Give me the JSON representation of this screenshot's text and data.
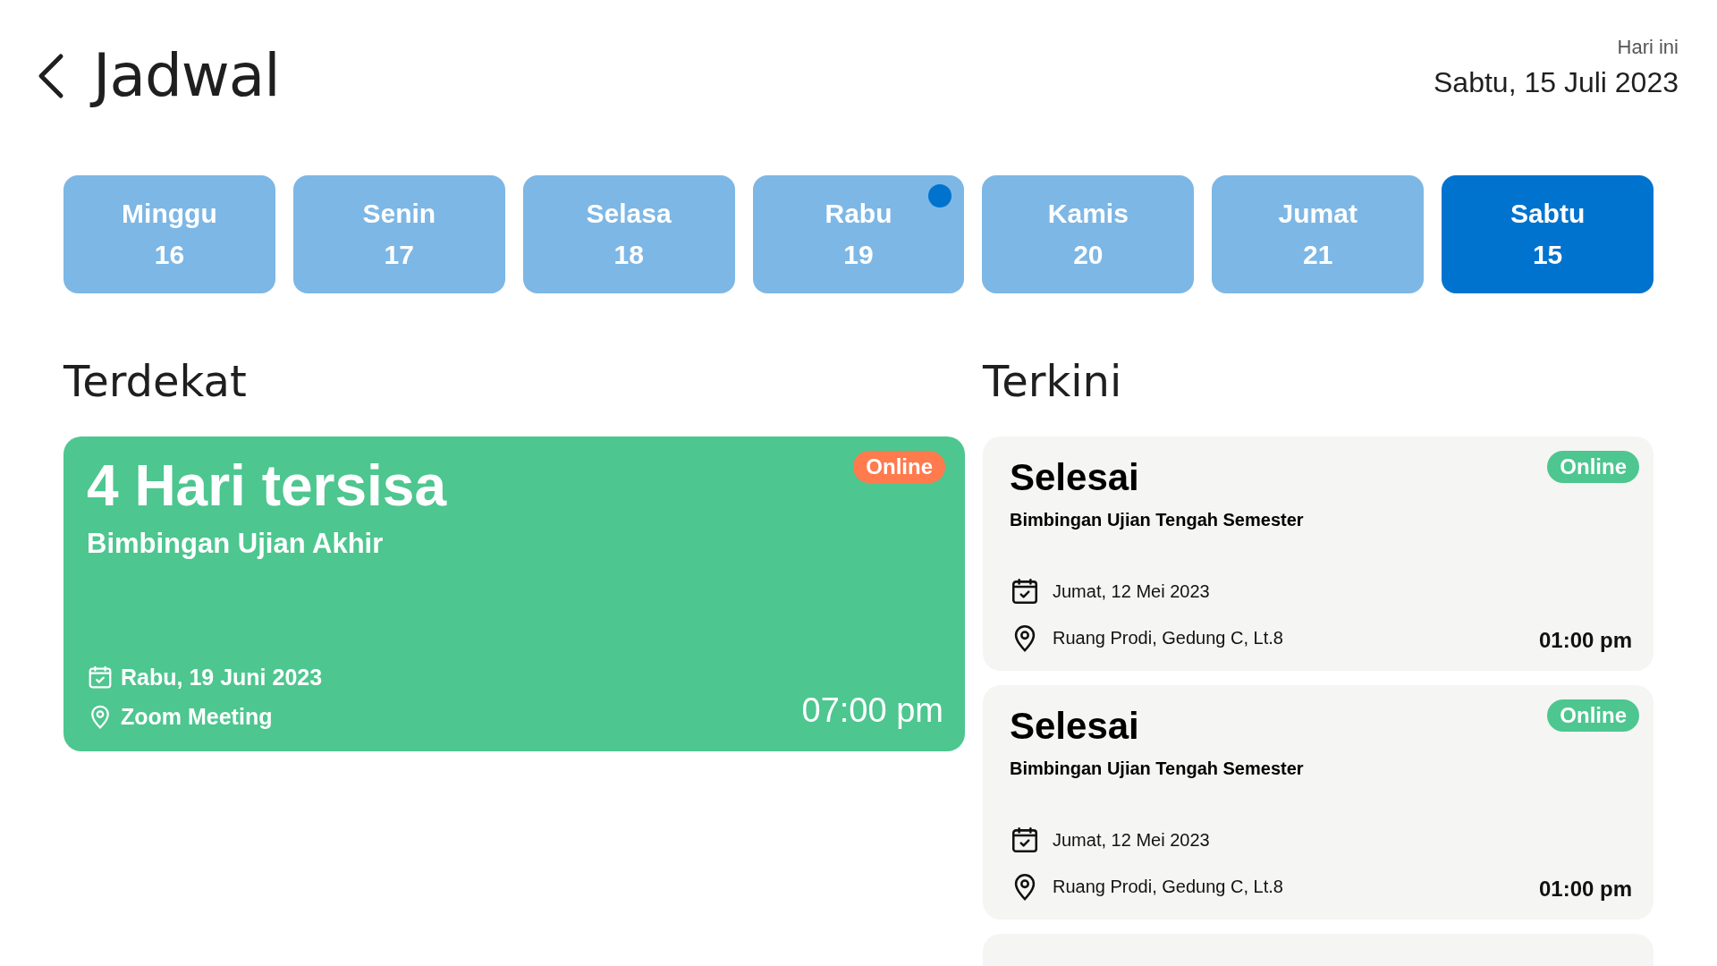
{
  "header": {
    "title": "Jadwal",
    "today_label": "Hari ini",
    "today_date": "Sabtu, 15 Juli 2023"
  },
  "days": [
    {
      "name": "Minggu",
      "date": "16",
      "selected": false,
      "has_event": false
    },
    {
      "name": "Senin",
      "date": "17",
      "selected": false,
      "has_event": false
    },
    {
      "name": "Selasa",
      "date": "18",
      "selected": false,
      "has_event": false
    },
    {
      "name": "Rabu",
      "date": "19",
      "selected": false,
      "has_event": true
    },
    {
      "name": "Kamis",
      "date": "20",
      "selected": false,
      "has_event": false
    },
    {
      "name": "Jumat",
      "date": "21",
      "selected": false,
      "has_event": false
    },
    {
      "name": "Sabtu",
      "date": "15",
      "selected": true,
      "has_event": false
    }
  ],
  "nearest": {
    "heading": "Terdekat",
    "card": {
      "title": "4 Hari tersisa",
      "subtitle": "Bimbingan Ujian Akhir",
      "badge": "Online",
      "date": "Rabu, 19 Juni 2023",
      "location": "Zoom Meeting",
      "time": "07:00 pm"
    }
  },
  "recent": {
    "heading": "Terkini",
    "cards": [
      {
        "title": "Selesai",
        "subtitle": "Bimbingan Ujian Tengah Semester",
        "badge": "Online",
        "date": "Jumat, 12 Mei 2023",
        "location": "Ruang Prodi, Gedung C, Lt.8",
        "time": "01:00 pm"
      },
      {
        "title": "Selesai",
        "subtitle": "Bimbingan Ujian Tengah Semester",
        "badge": "Online",
        "date": "Jumat, 12 Mei 2023",
        "location": "Ruang Prodi, Gedung C, Lt.8",
        "time": "01:00 pm"
      }
    ],
    "has_more": true
  }
}
